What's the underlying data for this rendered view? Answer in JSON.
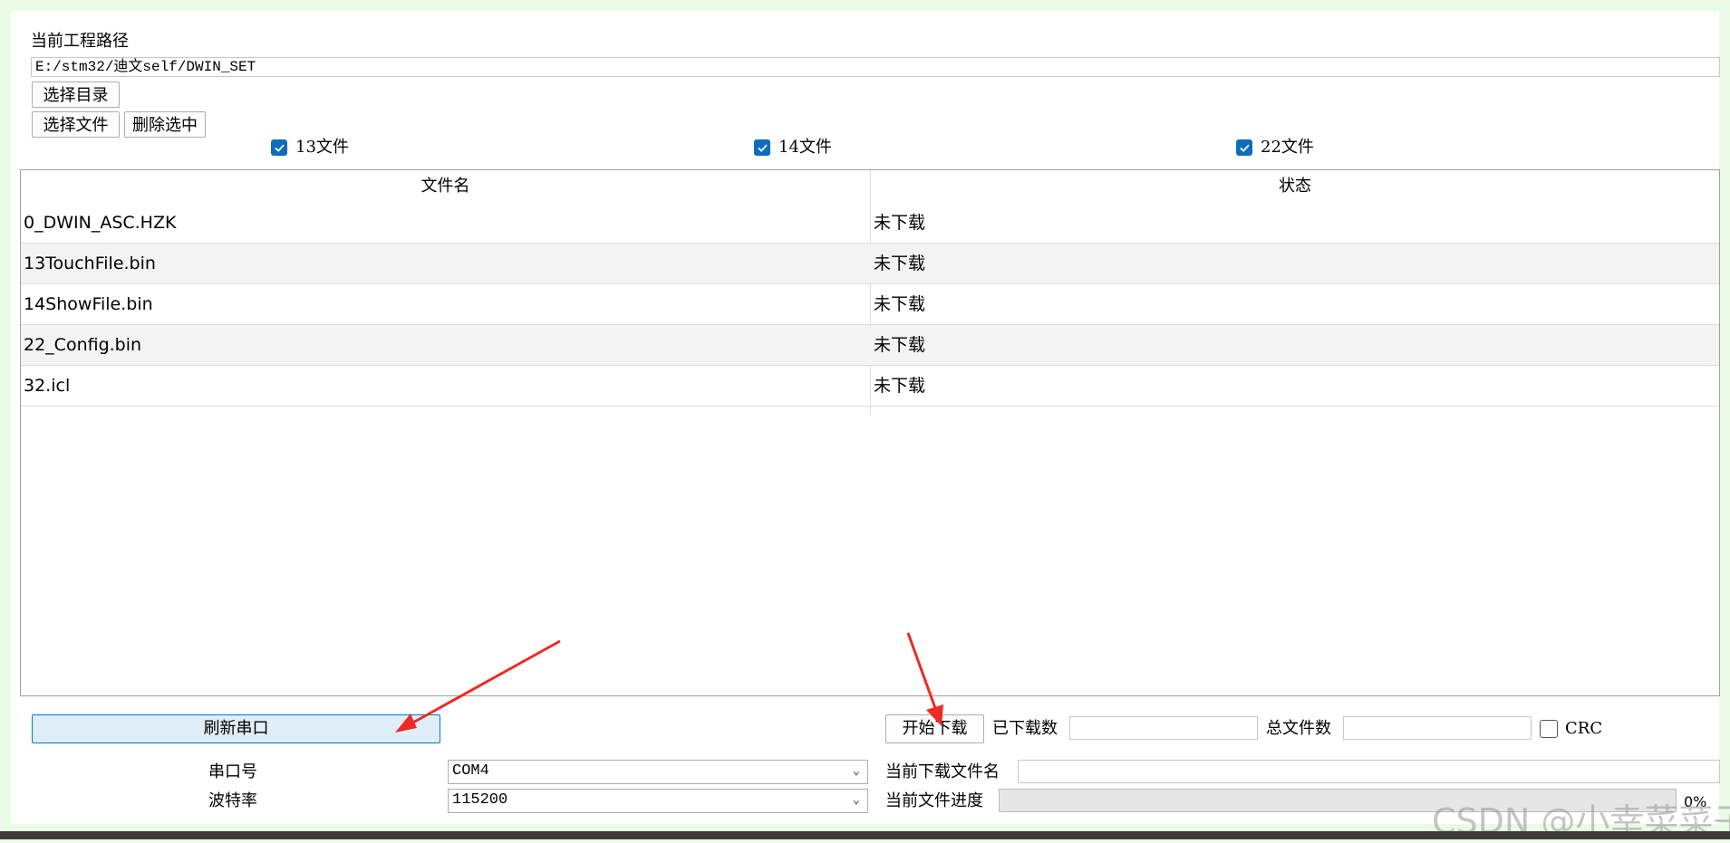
{
  "project": {
    "label": "当前工程路径",
    "path": "E:/stm32/迪文self/DWIN_SET",
    "choose_dir_label": "选择目录",
    "choose_file_label": "选择文件",
    "delete_selected_label": "删除选中"
  },
  "filters": [
    {
      "label": "13文件",
      "checked": true
    },
    {
      "label": "14文件",
      "checked": true
    },
    {
      "label": "22文件",
      "checked": true
    }
  ],
  "table": {
    "headers": [
      "文件名",
      "状态"
    ],
    "rows": [
      {
        "name": "0_DWIN_ASC.HZK",
        "status": "未下载"
      },
      {
        "name": "13TouchFile.bin",
        "status": "未下载"
      },
      {
        "name": "14ShowFile.bin",
        "status": "未下载"
      },
      {
        "name": "22_Config.bin",
        "status": "未下载"
      },
      {
        "name": "32.icl",
        "status": "未下载"
      }
    ]
  },
  "serial": {
    "refresh_label": "刷新串口",
    "port_label": "串口号",
    "port_value": "COM4",
    "baud_label": "波特率",
    "baud_value": "115200"
  },
  "download": {
    "start_label": "开始下载",
    "downloaded_label": "已下载数",
    "downloaded_value": "",
    "total_label": "总文件数",
    "total_value": "",
    "crc_label": "CRC",
    "crc_checked": false,
    "current_file_label": "当前下载文件名",
    "current_file_value": "",
    "progress_label": "当前文件进度",
    "progress_percent": 0,
    "progress_text": "0%"
  },
  "watermark": "CSDN @小幸菜菜子",
  "colors": {
    "accent": "#0f6cbd",
    "annotation_arrow": "#ee2a24",
    "highlight_button": "#e0eef9"
  },
  "icons": [
    "check-icon",
    "dropdown-chevron-icon",
    "red-arrow-annotation"
  ]
}
